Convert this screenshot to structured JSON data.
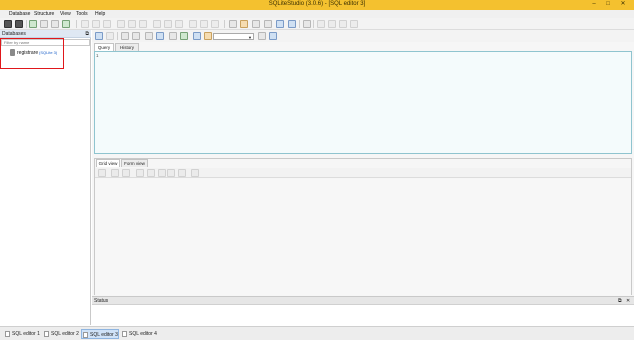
{
  "window": {
    "title": "SQLiteStudio (3.0.6) - [SQL editor 3]",
    "controls": [
      "–",
      "□",
      "✕"
    ]
  },
  "menubar": [
    "Database",
    "Structure",
    "View",
    "Tools",
    "Help"
  ],
  "databases_panel": {
    "title": "Databases",
    "float_symbol": "⧉",
    "filter_placeholder": "Filter by name",
    "items": [
      {
        "name": "registrare",
        "version": "(SQLite 3)"
      }
    ]
  },
  "editor": {
    "tabs": [
      {
        "label": "Query",
        "active": true
      },
      {
        "label": "History",
        "active": false
      }
    ],
    "line_number": "1"
  },
  "results": {
    "tabs": [
      {
        "label": "Grid view",
        "active": true
      },
      {
        "label": "Form view",
        "active": false
      }
    ]
  },
  "status_panel": {
    "title": "Status",
    "controls": [
      "⧉",
      "✕"
    ]
  },
  "window_tabs": [
    {
      "label": "SQL editor 1",
      "active": false
    },
    {
      "label": "SQL editor 2",
      "active": false
    },
    {
      "label": "SQL editor 3",
      "active": true
    },
    {
      "label": "SQL editor 4",
      "active": false
    }
  ],
  "icons": {
    "main_toolbar": [
      "connect-icon",
      "disconnect-icon",
      "add-database-icon",
      "edit-database-icon",
      "remove-database-icon",
      "refresh-icon",
      "create-table-icon",
      "edit-table-icon",
      "delete-table-icon",
      "create-index-icon",
      "create-trigger-icon",
      "create-view-icon",
      "sql-editor-icon",
      "function-icon",
      "collation-icon",
      "tile-icon",
      "cascade-icon",
      "settings-icon",
      "panel-icons"
    ],
    "editor_toolbar": [
      "execute-icon",
      "explain-icon",
      "format-icon",
      "clear-icon",
      "new-icon",
      "print-icon",
      "export-icon",
      "import-icon",
      "save-icon",
      "open-icon",
      "database-selector-icon"
    ]
  },
  "colors": {
    "titlebar": "#f4c12f",
    "highlight_box": "#e0171b",
    "active_tab": "#cfe2f7",
    "db_version": "#1a5fc8",
    "query_border": "#8fc4cf"
  }
}
